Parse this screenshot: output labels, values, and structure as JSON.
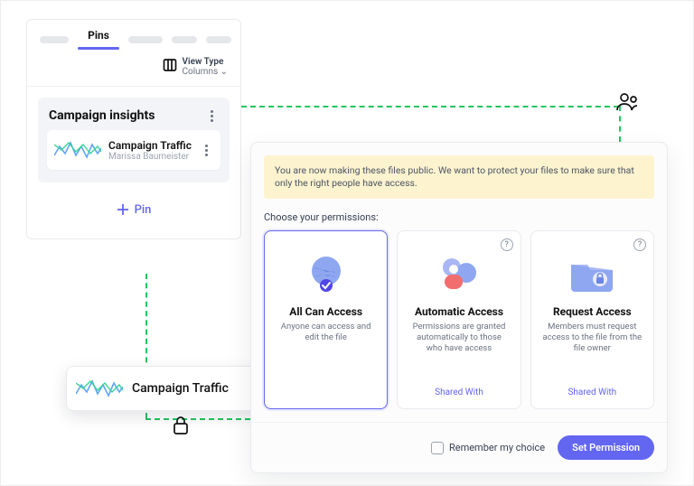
{
  "pins_panel": {
    "active_tab": "Pins",
    "view_type_label": "View Type",
    "view_type_value": "Columns",
    "section_title": "Campaign insights",
    "item": {
      "title": "Campaign Traffic",
      "subtitle": "Marissa Baumeister"
    },
    "pin_button": "Pin"
  },
  "float_card": {
    "title": "Campaign Traffic"
  },
  "permissions": {
    "banner": "You are now making these files public. We want to protect your files to make sure that only the right people have access.",
    "choose_label": "Choose your permissions:",
    "options": [
      {
        "title": "All Can Access",
        "desc": "Anyone can access and edit the file",
        "shared": ""
      },
      {
        "title": "Automatic Access",
        "desc": "Permissions are granted automatically to those who have access",
        "shared": "Shared With"
      },
      {
        "title": "Request Access",
        "desc": "Members must request access to the file from the file owner",
        "shared": "Shared With"
      }
    ],
    "remember": "Remember my choice",
    "set_button": "Set Permission"
  }
}
